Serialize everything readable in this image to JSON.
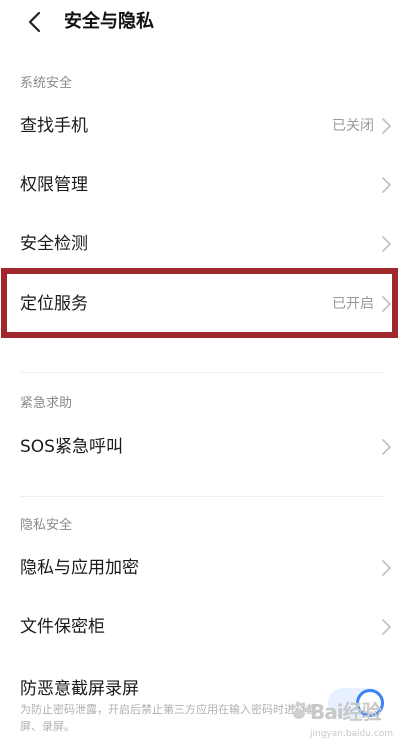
{
  "header": {
    "title": "安全与隐私",
    "back_icon": "chevron-left-icon"
  },
  "sections": {
    "system_security": {
      "label": "系统安全",
      "items": [
        {
          "label": "查找手机",
          "value": "已关闭"
        },
        {
          "label": "权限管理",
          "value": ""
        },
        {
          "label": "安全检测",
          "value": ""
        },
        {
          "label": "定位服务",
          "value": "已开启"
        }
      ]
    },
    "emergency": {
      "label": "紧急求助",
      "items": [
        {
          "label": "SOS紧急呼叫",
          "value": ""
        }
      ]
    },
    "privacy_security": {
      "label": "隐私安全",
      "items": [
        {
          "label": "隐私与应用加密",
          "value": ""
        },
        {
          "label": "文件保密柜",
          "value": ""
        },
        {
          "label": "防恶意截屏录屏",
          "description": "为防止密码泄露，开启后禁止第三方应用在输入密码时进行截屏、录屏。",
          "toggle_on": true
        }
      ]
    }
  },
  "highlight_color": "#a1282a",
  "accent_color": "#3b82f6",
  "watermark": {
    "logo": "Bai经验",
    "url": "jingyan.baidu.com"
  }
}
